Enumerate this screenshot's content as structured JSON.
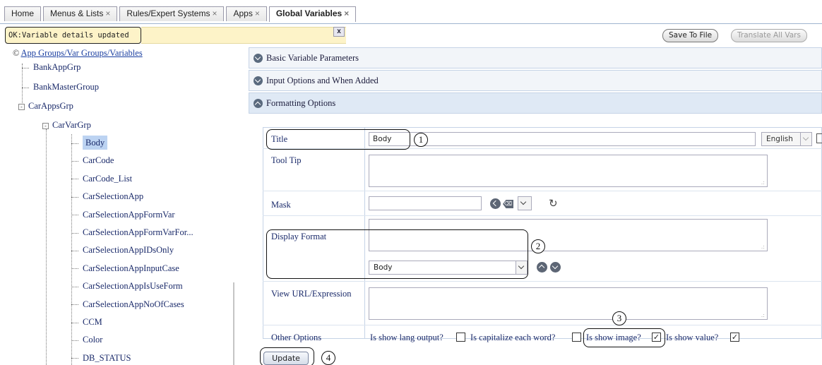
{
  "tabs": [
    {
      "label": "Home",
      "closable": false,
      "active": false
    },
    {
      "label": "Menus & Lists",
      "closable": true,
      "active": false
    },
    {
      "label": "Rules/Expert Systems",
      "closable": true,
      "active": false
    },
    {
      "label": "Apps",
      "closable": true,
      "active": false
    },
    {
      "label": "Global Variables",
      "closable": true,
      "active": true
    }
  ],
  "tab_close_glyph": "×",
  "status": {
    "message": "OK:Variable details updated",
    "close_label": "x",
    "background": "#fdf3c8"
  },
  "toolbar": {
    "save_label": "Save To File",
    "translate_label": "Translate All Vars"
  },
  "tree": {
    "header_icon": "©",
    "header": "App Groups/Var Groups/Variables",
    "groups": [
      "BankAppGrp",
      "BankMasterGroup",
      "CarAppsGrp"
    ],
    "subgroup": "CarVarGrp",
    "variables": [
      "Body",
      "CarCode",
      "CarCode_List",
      "CarSelectionApp",
      "CarSelectionAppFormVar",
      "CarSelectionAppFormVarFor...",
      "CarSelectionAppIDsOnly",
      "CarSelectionAppInputCase",
      "CarSelectionAppIsUseForm",
      "CarSelectionAppNoOfCases",
      "CCM",
      "Color",
      "DB_STATUS"
    ],
    "expand_glyph": "-",
    "selected": "Body"
  },
  "sections": {
    "basic": "Basic Variable Parameters",
    "input": "Input Options and When Added",
    "formatting": "Formatting Options"
  },
  "form": {
    "title_label": "Title",
    "title_value": "Body",
    "language": "English",
    "tooltip_label": "Tool Tip",
    "mask_label": "Mask",
    "back_glyph": "⌫",
    "refresh_glyph": "↻",
    "display_format_label": "Display Format",
    "display_format_value": "Body",
    "view_url_label": "View URL/Expression",
    "other_options_label": "Other Options",
    "resize_grip": ".:",
    "options": [
      {
        "label": "Is show lang output?",
        "checked": false
      },
      {
        "label": "Is capitalize each word?",
        "checked": false
      },
      {
        "label": "Is show image?",
        "checked": true
      },
      {
        "label": "Is show value?",
        "checked": true
      }
    ],
    "check_glyph": "✓",
    "update_label": "Update"
  },
  "callouts": [
    "1",
    "2",
    "3",
    "4"
  ],
  "colors": {
    "accent": "#1a3ea0",
    "selected_bg": "#bcd3f2",
    "status_bg": "#fdf3c8"
  },
  "icons": [
    "close-icon",
    "chevron-down-icon",
    "chevron-up-icon",
    "back-icon",
    "refresh-icon",
    "checkbox-icon"
  ]
}
